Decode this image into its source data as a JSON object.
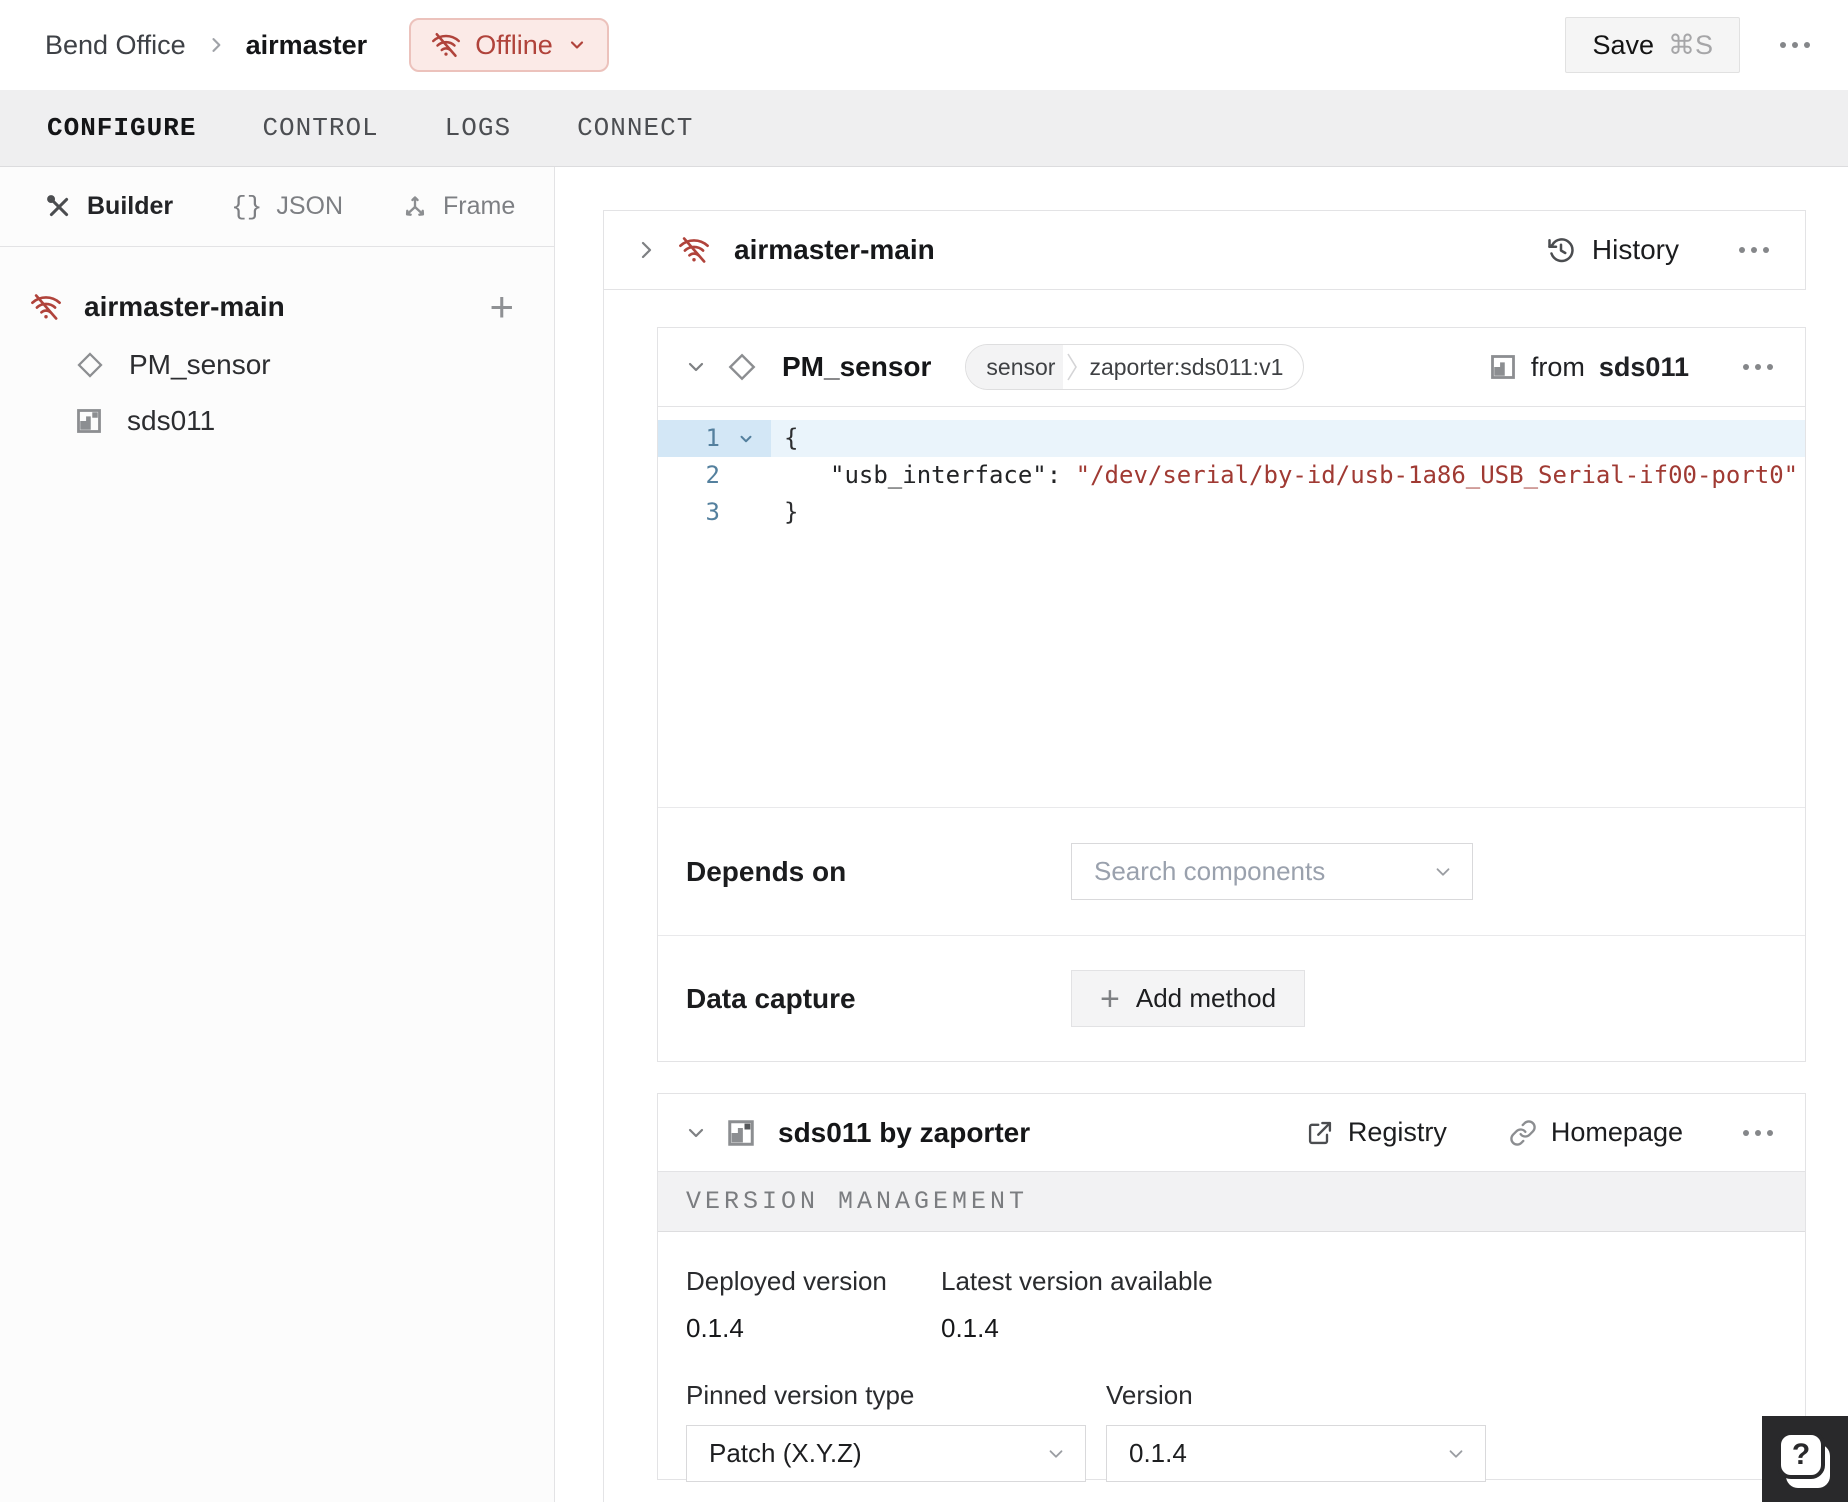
{
  "header": {
    "breadcrumb": [
      "Bend Office",
      "airmaster"
    ],
    "status": {
      "label": "Offline"
    },
    "save": {
      "label": "Save",
      "shortcut": "⌘S"
    }
  },
  "tabs": [
    {
      "label": "CONFIGURE",
      "active": true
    },
    {
      "label": "CONTROL",
      "active": false
    },
    {
      "label": "LOGS",
      "active": false
    },
    {
      "label": "CONNECT",
      "active": false
    }
  ],
  "sidebar": {
    "modes": [
      {
        "label": "Builder"
      },
      {
        "label": "JSON"
      },
      {
        "label": "Frame"
      }
    ],
    "json_icon_glyph": "{}",
    "tree": {
      "root": {
        "label": "airmaster-main"
      },
      "children": [
        {
          "label": "PM_sensor"
        },
        {
          "label": "sds011"
        }
      ]
    }
  },
  "icons": {
    "plus": "+",
    "help": "?"
  },
  "main": {
    "machine_card": {
      "title": "airmaster-main",
      "history_label": "History"
    },
    "component_card": {
      "title": "PM_sensor",
      "badge": {
        "type": "sensor",
        "model": "zaporter:sds011:v1"
      },
      "from_prefix": "from",
      "from_target": "sds011",
      "code": {
        "line1": {
          "num": "1",
          "text": "{"
        },
        "line2": {
          "num": "2",
          "key": "\"usb_interface\"",
          "colon": ": ",
          "value": "\"/dev/serial/by-id/usb-1a86_USB_Serial-if00-port0\""
        },
        "line3": {
          "num": "3",
          "text": "}"
        }
      },
      "depends_on": {
        "label": "Depends on",
        "placeholder": "Search components"
      },
      "data_capture": {
        "label": "Data capture",
        "button_label": "Add method"
      }
    },
    "module_card": {
      "title": "sds011 by zaporter",
      "registry_label": "Registry",
      "homepage_label": "Homepage",
      "section_title": "VERSION MANAGEMENT",
      "deployed": {
        "label": "Deployed version",
        "value": "0.1.4"
      },
      "latest": {
        "label": "Latest version available",
        "value": "0.1.4"
      },
      "pinned": {
        "label": "Pinned version type",
        "value": "Patch (X.Y.Z)"
      },
      "version": {
        "label": "Version",
        "value": "0.1.4"
      }
    }
  },
  "colors": {
    "danger_red": "#b0433b",
    "code_string": "#a03a33",
    "line_highlight": "#eaf4fb",
    "tab_bar_bg": "#efeff0"
  }
}
